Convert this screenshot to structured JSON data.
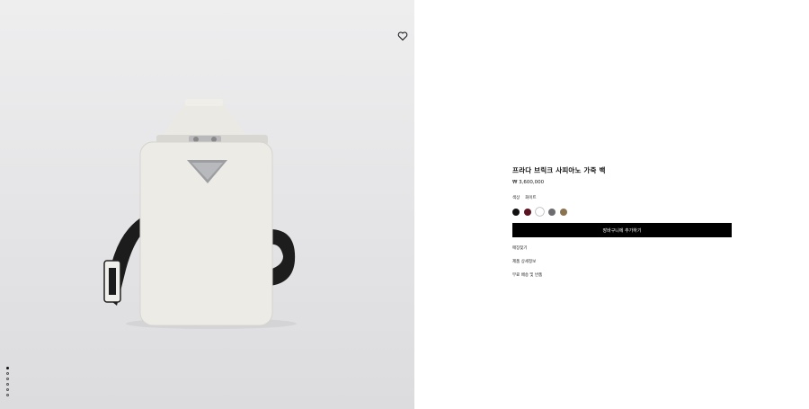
{
  "product": {
    "title": "프라다 브릭크 사피아노 가죽 백",
    "price": "₩ 3,600,000",
    "color_label": "색상",
    "color_value": "화이트",
    "swatches": [
      {
        "name": "black",
        "color": "#111111"
      },
      {
        "name": "burgundy",
        "color": "#5a1422"
      },
      {
        "name": "white",
        "color": "#ffffff"
      },
      {
        "name": "gray",
        "color": "#6d6d70"
      },
      {
        "name": "brown",
        "color": "#8a7350"
      }
    ],
    "add_to_cart": "장바구니에 추가하기",
    "links": [
      "매장찾기",
      "제품 상세정보",
      "무료 배송 및 반품"
    ]
  },
  "gallery": {
    "image_count": 6,
    "active_index": 0
  }
}
